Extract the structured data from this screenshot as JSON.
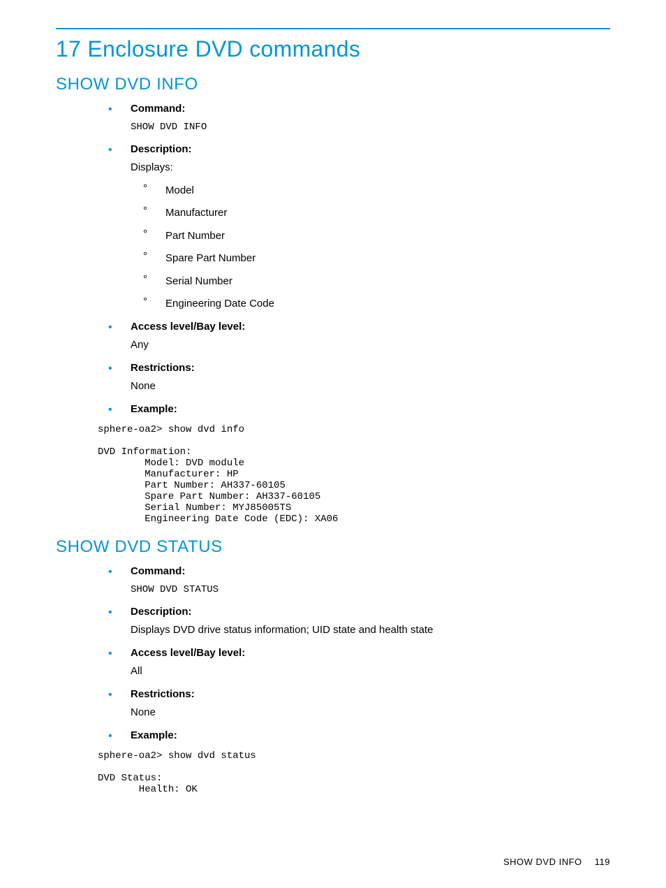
{
  "chapter_title": "17 Enclosure DVD commands",
  "sections": [
    {
      "heading": "SHOW DVD INFO",
      "command_label": "Command:",
      "command_value": "SHOW DVD INFO",
      "description_label": "Description:",
      "description_intro": "Displays:",
      "description_items": [
        "Model",
        "Manufacturer",
        "Part Number",
        "Spare Part Number",
        "Serial Number",
        "Engineering Date Code"
      ],
      "access_label": "Access level/Bay level:",
      "access_value": "Any",
      "restrictions_label": "Restrictions:",
      "restrictions_value": "None",
      "example_label": "Example:",
      "example_text": "sphere-oa2> show dvd info\n\nDVD Information:\n        Model: DVD module\n        Manufacturer: HP\n        Part Number: AH337-60105\n        Spare Part Number: AH337-60105\n        Serial Number: MYJ85005TS\n        Engineering Date Code (EDC): XA06"
    },
    {
      "heading": "SHOW DVD STATUS",
      "command_label": "Command:",
      "command_value": "SHOW DVD STATUS",
      "description_label": "Description:",
      "description_text": "Displays DVD drive status information; UID state and health state",
      "access_label": "Access level/Bay level:",
      "access_value": "All",
      "restrictions_label": "Restrictions:",
      "restrictions_value": "None",
      "example_label": "Example:",
      "example_text": "sphere-oa2> show dvd status\n\nDVD Status:\n       Health: OK"
    }
  ],
  "footer_section": "SHOW DVD INFO",
  "footer_page": "119"
}
